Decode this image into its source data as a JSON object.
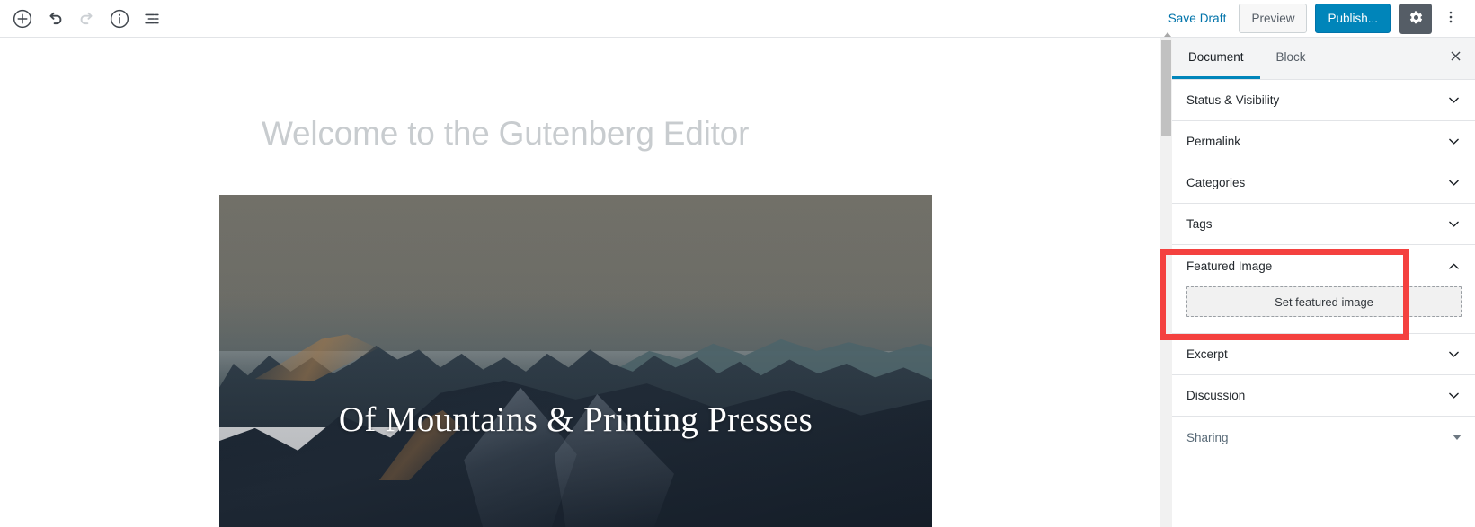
{
  "toolbar": {
    "left_tools": [
      {
        "name": "add-block-icon",
        "label": "Add block"
      },
      {
        "name": "undo-icon",
        "label": "Undo"
      },
      {
        "name": "redo-icon",
        "label": "Redo"
      },
      {
        "name": "content-info-icon",
        "label": "Content structure"
      },
      {
        "name": "block-navigation-icon",
        "label": "Block navigation"
      }
    ],
    "save_draft_label": "Save Draft",
    "preview_label": "Preview",
    "publish_label": "Publish...",
    "settings_icon": "gear-icon",
    "more_icon": "kebab-menu-icon"
  },
  "editor": {
    "post_title_placeholder": "Welcome to the Gutenberg Editor",
    "cover_block": {
      "heading": "Of Mountains & Printing Presses",
      "alt": "mountain range at dusk"
    }
  },
  "sidebar": {
    "tabs": [
      {
        "label": "Document",
        "active": true
      },
      {
        "label": "Block",
        "active": false
      }
    ],
    "close_label": "✕",
    "panels": [
      {
        "label": "Status & Visibility",
        "expanded": false
      },
      {
        "label": "Permalink",
        "expanded": false
      },
      {
        "label": "Categories",
        "expanded": false
      },
      {
        "label": "Tags",
        "expanded": false
      }
    ],
    "featured_image": {
      "label": "Featured Image",
      "expanded": true,
      "set_button_label": "Set featured image"
    },
    "panels_after": [
      {
        "label": "Excerpt",
        "expanded": false
      },
      {
        "label": "Discussion",
        "expanded": false
      }
    ],
    "sharing": {
      "label": "Sharing",
      "expanded": false
    }
  },
  "highlight": {
    "target": "Featured Image",
    "color": "#f4413f"
  },
  "colors": {
    "publish_blue": "#0085ba",
    "link_blue": "#0073aa",
    "gear_gray": "#555d66",
    "highlight_red": "#f4413f"
  }
}
